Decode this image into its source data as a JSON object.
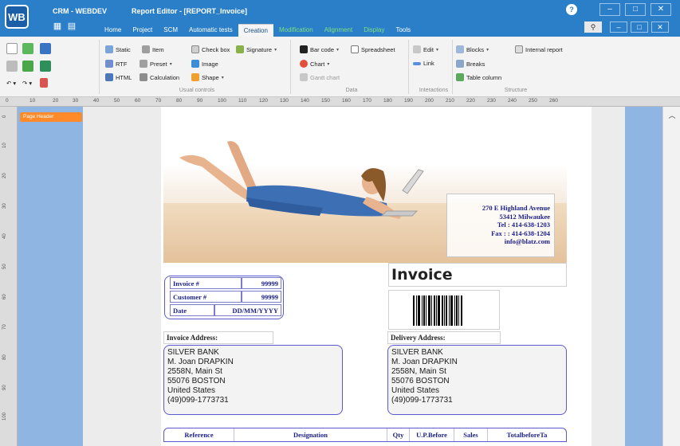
{
  "titlebar": {
    "logo": "WB",
    "app_name": "CRM - WEBDEV",
    "document": "Report Editor - [REPORT_Invoice]",
    "tabs": [
      "Home",
      "Project",
      "SCM",
      "Automatic tests",
      "Creation",
      "Modification",
      "Alignment",
      "Display",
      "Tools"
    ],
    "active_tab": "Creation",
    "window_controls": [
      "–",
      "□",
      "✕"
    ]
  },
  "ribbon": {
    "usual_controls": {
      "label": "Usual controls",
      "items": [
        "Static",
        "Item",
        "Check box",
        "Signature",
        "RTF",
        "Preset",
        "Image",
        "HTML",
        "Calculation",
        "Shape"
      ]
    },
    "data": {
      "label": "Data",
      "items": [
        "Bar code",
        "Spreadsheet",
        "Chart",
        "Gantt chart"
      ]
    },
    "interactions": {
      "label": "Interactions",
      "items": [
        "Edit",
        "Link"
      ]
    },
    "structure": {
      "label": "Structure",
      "items": [
        "Blocks",
        "Internal report",
        "Breaks",
        "Table column"
      ]
    }
  },
  "ruler_ticks": [
    "0",
    "10",
    "20",
    "30",
    "40",
    "50",
    "60",
    "70",
    "80",
    "90",
    "100",
    "110",
    "120",
    "130",
    "140",
    "150",
    "160",
    "170",
    "180",
    "190",
    "200",
    "210",
    "220",
    "230",
    "240",
    "250",
    "260"
  ],
  "vruler_ticks": [
    "0",
    "10",
    "20",
    "30",
    "40",
    "50",
    "60",
    "70",
    "80",
    "90",
    "100"
  ],
  "section_label": "Page Header",
  "company": {
    "line1": "270 E Highland Avenue",
    "line2": "53412  Milwaukee",
    "line3": "Tel : 414-638-1203",
    "line4": "Fax : : 414-638-1204",
    "line5": "info@blatz.com"
  },
  "invoice": {
    "title": "Invoice",
    "invoice_label": "Invoice #",
    "invoice_value": "99999",
    "customer_label": "Customer #",
    "customer_value": "99999",
    "date_label": "Date",
    "date_value": "DD/MM/YYYY"
  },
  "invoice_address": {
    "label": "Invoice Address:",
    "lines": [
      "SILVER BANK",
      "M. Joan DRAPKIN",
      "2558N, Main St",
      "55076  BOSTON",
      "United States",
      "(49)099-1773731"
    ]
  },
  "delivery_address": {
    "label": "Delivery Address:",
    "lines": [
      "SILVER BANK",
      "M. Joan DRAPKIN",
      "2558N, Main St",
      "55076  BOSTON",
      "United States",
      "(49)099-1773731"
    ]
  },
  "table_columns": [
    "Reference",
    "Designation",
    "Qty",
    "U.P.Before",
    "Sales",
    "TotalbeforeTa"
  ],
  "colors": {
    "titlebar": "#2b7fc9",
    "margin": "#8fb6e2",
    "section_tab": "#ff8a2a",
    "report_text": "#1b1f8a"
  }
}
